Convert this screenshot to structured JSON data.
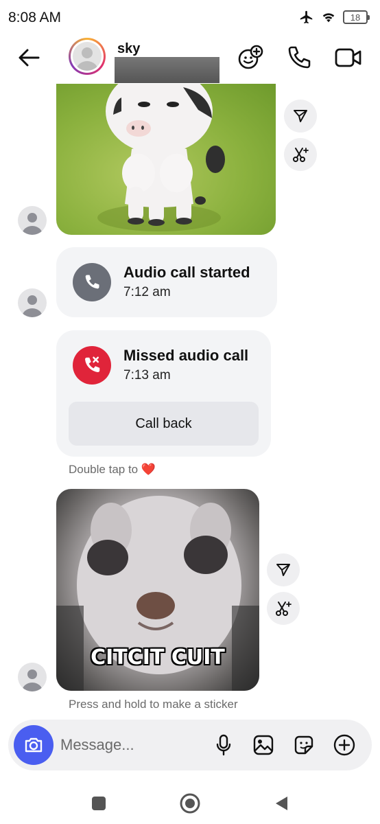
{
  "status": {
    "time": "8:08 AM",
    "battery": "18",
    "icons": [
      "airplane-icon",
      "wifi-icon",
      "battery-icon"
    ]
  },
  "header": {
    "contact_name": "sky",
    "icons": [
      "back-arrow-icon",
      "add-effect-icon",
      "phone-icon",
      "video-icon"
    ]
  },
  "messages": {
    "audio_call": {
      "title": "Audio call started",
      "time": "7:12 am"
    },
    "missed_call": {
      "title": "Missed audio call",
      "time": "7:13 am",
      "button": "Call back"
    },
    "hint_double_tap": "Double tap to",
    "hint_emoji": "❤️",
    "meme_caption": "CITCIT CUIT",
    "hint_sticker": "Press and hold to make a sticker"
  },
  "composer": {
    "placeholder": "Message...",
    "icons": [
      "camera-icon",
      "microphone-icon",
      "gallery-icon",
      "sticker-icon",
      "plus-circle-icon"
    ]
  },
  "colors": {
    "accent": "#4a5ef0",
    "missed": "#e0243a",
    "call_grey": "#6b6f78",
    "card_bg": "#f3f4f6"
  }
}
